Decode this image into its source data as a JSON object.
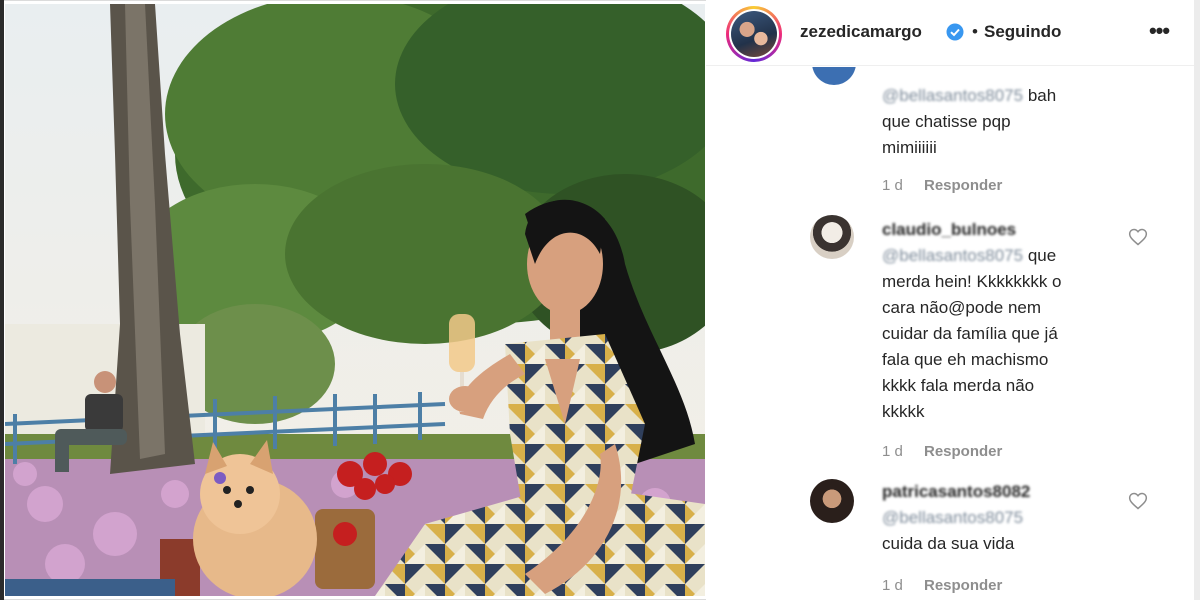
{
  "post": {
    "author": "zezedicamargo",
    "separator": "•",
    "follow_status": "Seguindo",
    "more_label": "•••"
  },
  "comments": [
    {
      "user": "",
      "mention": "@bellasantos8075",
      "text_after_mention": " bah",
      "lines": [
        "que chatisse pqp",
        "mimiiiiii"
      ],
      "time": "1 d",
      "reply": "Responder"
    },
    {
      "user": "claudio_bulnoes",
      "mention": "@bellasantos8075",
      "text_after_mention": " que",
      "lines": [
        "merda hein! Kkkkkkkk o",
        "cara não@pode nem",
        "cuidar da família que já",
        "fala que eh machismo",
        "kkkk fala merda não",
        "kkkkk"
      ],
      "time": "1 d",
      "reply": "Responder"
    },
    {
      "user": "patricasantos8082",
      "mention": "@bellasantos8075",
      "text_after_mention": "",
      "lines": [
        "cuida da sua vida"
      ],
      "time": "1 d",
      "reply": "Responder"
    }
  ],
  "icons": {
    "verified": "verified-badge-icon",
    "like": "heart-icon",
    "more": "more-options-icon"
  },
  "colors": {
    "verified_blue": "#3897f0",
    "meta_gray": "#8e8e8e",
    "text": "#262626"
  }
}
